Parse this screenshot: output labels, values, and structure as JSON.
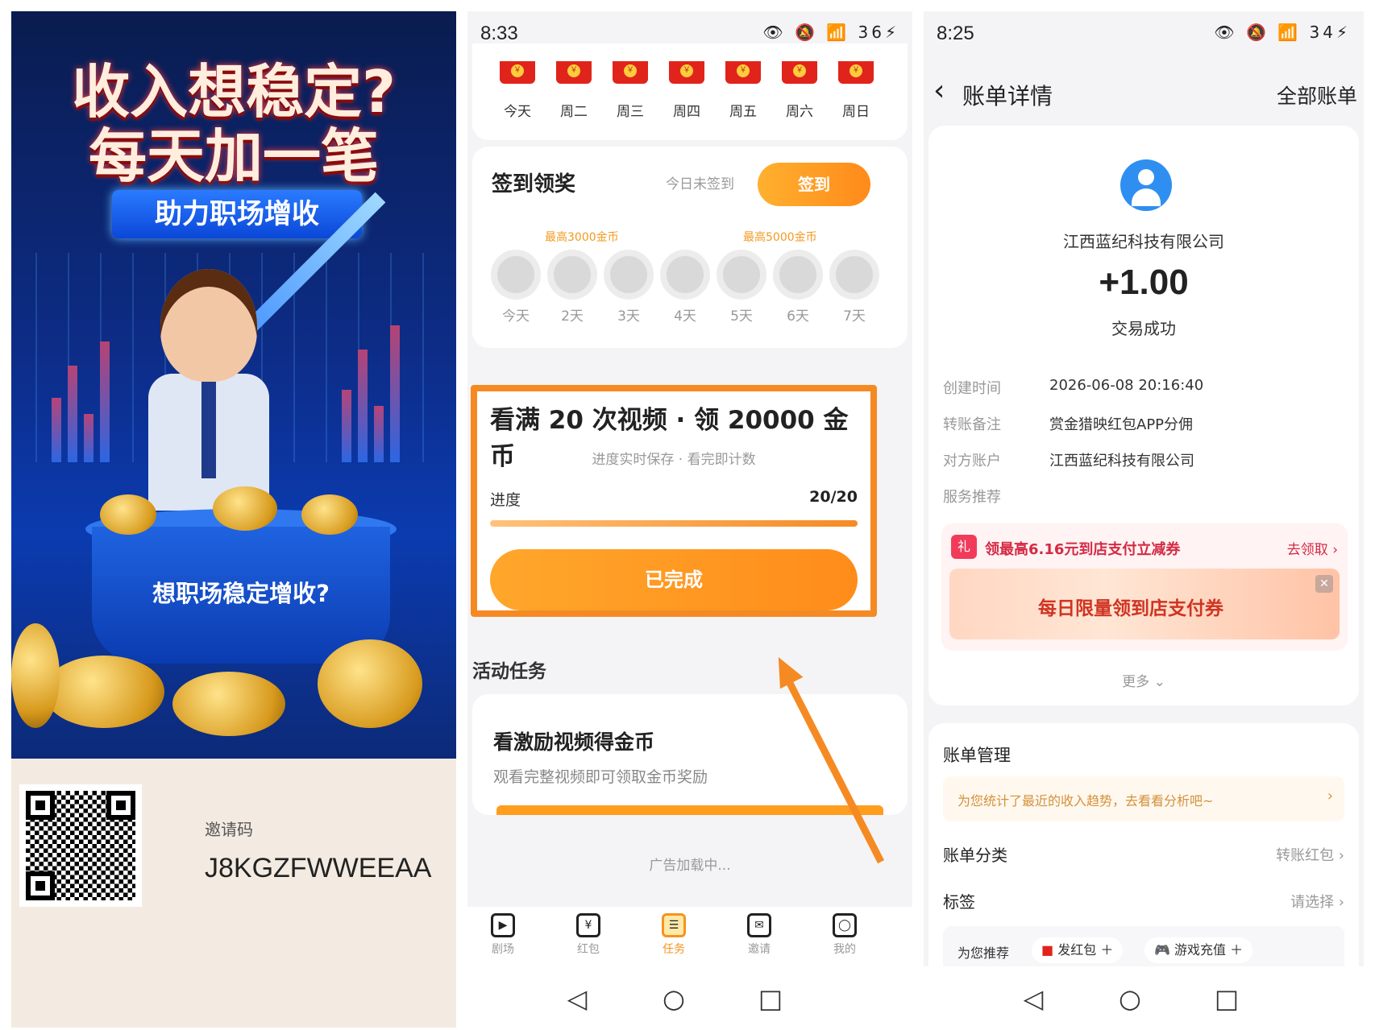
{
  "poster": {
    "headline_line1": "收入想稳定?",
    "headline_line2": "每天加一笔",
    "banner": "助力职场增收",
    "bucket_text": "想职场稳定增收?",
    "invite_label": "邀请码",
    "invite_code": "J8KGZFWWEEAA"
  },
  "tasks_screen": {
    "status": {
      "time": "8:33",
      "battery": "36"
    },
    "week": [
      "今天",
      "周二",
      "周三",
      "周四",
      "周五",
      "周六",
      "周日"
    ],
    "signin": {
      "title": "签到领奖",
      "status": "今日未签到",
      "button": "签到",
      "reward_notes": [
        "最高3000金币",
        "最高5000金币"
      ],
      "days": [
        "今天",
        "2天",
        "3天",
        "4天",
        "5天",
        "6天",
        "7天"
      ]
    },
    "video_task": {
      "title": "看满 20 次视频 · 领 20000 金币",
      "subtitle": "进度实时保存 · 看完即计数",
      "progress_label": "进度",
      "progress_count": "20/20",
      "progress_fraction": 1.0,
      "button": "已完成"
    },
    "section_title": "活动任务",
    "activity": {
      "title": "看激励视频得金币",
      "subtitle": "观看完整视频即可领取金币奖励"
    },
    "ad_loading": "广告加载中...",
    "tabs": [
      {
        "label": "剧场",
        "icon": "play-icon"
      },
      {
        "label": "红包",
        "icon": "red-packet-icon"
      },
      {
        "label": "任务",
        "icon": "task-icon"
      },
      {
        "label": "邀请",
        "icon": "mail-icon"
      },
      {
        "label": "我的",
        "icon": "user-icon"
      }
    ],
    "active_tab": "任务"
  },
  "bill_screen": {
    "status": {
      "time": "8:25",
      "battery": "34"
    },
    "title": "账单详情",
    "all_bills": "全部账单",
    "payer": "江西蓝纪科技有限公司",
    "amount": "+1.00",
    "trade_status": "交易成功",
    "details": [
      {
        "label": "创建时间",
        "value": "2026-06-08 20:16:40"
      },
      {
        "label": "转账备注",
        "value": "赏金猎映红包APP分佣"
      },
      {
        "label": "对方账户",
        "value": "江西蓝纪科技有限公司"
      },
      {
        "label": "服务推荐",
        "value": ""
      }
    ],
    "promo": {
      "gift": "礼",
      "title": "领最高6.16元到店支付立减券",
      "link": "去领取",
      "banner": "每日限量领到店支付券"
    },
    "more": "更多",
    "manage": {
      "title": "账单管理",
      "trend": "为您统计了最近的收入趋势，去看看分析吧~",
      "category_label": "账单分类",
      "category_value": "转账红包",
      "tag_label": "标签",
      "tag_value": "请选择",
      "rec_label": "为您推荐",
      "chips": [
        "发红包",
        "游戏充值"
      ]
    }
  },
  "colors": {
    "accent_orange": "#f58a23",
    "alipay_blue": "#2f8ff0",
    "promo_red": "#d42a45"
  }
}
